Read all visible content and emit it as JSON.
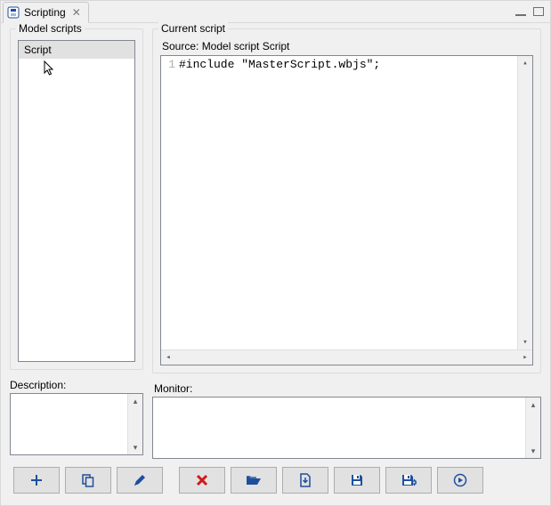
{
  "tab": {
    "title": "Scripting",
    "close_glyph": "✕"
  },
  "left": {
    "group_label": "Model scripts",
    "items": [
      "Script"
    ],
    "description_label": "Description:"
  },
  "right": {
    "group_label": "Current script",
    "source_label": "Source: Model script Script",
    "code_lines": [
      {
        "num": "1",
        "text": "#include \"MasterScript.wbjs\";"
      }
    ],
    "monitor_label": "Monitor:"
  },
  "toolbar": {
    "add": "Add",
    "copy": "Copy",
    "edit": "Edit",
    "delete": "Delete",
    "open": "Open",
    "import": "Import",
    "save": "Save",
    "save_as": "Save As",
    "run": "Run"
  },
  "colors": {
    "icon_blue": "#1e4f9c",
    "icon_red": "#d11919"
  }
}
